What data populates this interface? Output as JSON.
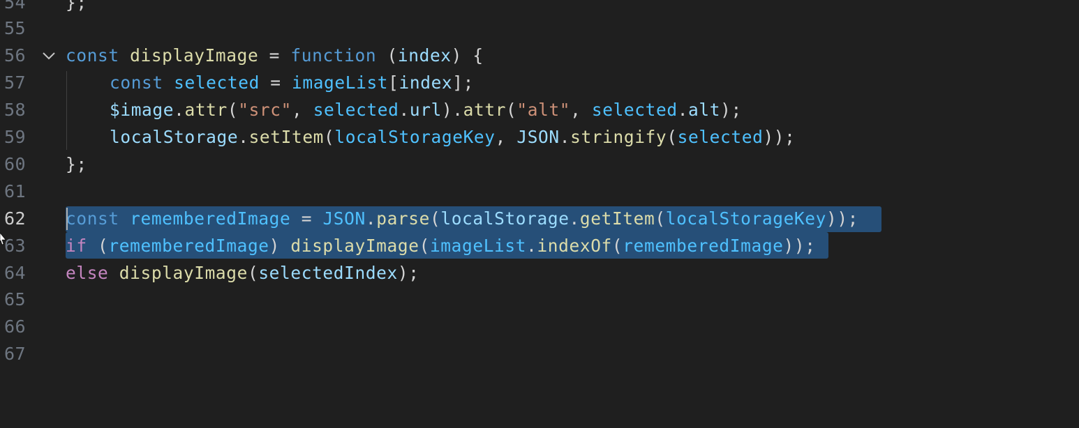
{
  "editor": {
    "active_line": "62",
    "lines": [
      {
        "number": "54",
        "code": "};"
      },
      {
        "number": "55",
        "code": ""
      },
      {
        "number": "56",
        "code": "const displayImage = function (index) {"
      },
      {
        "number": "57",
        "code": "const selected = imageList[index];"
      },
      {
        "number": "58",
        "code": "$image.attr(\"src\", selected.url).attr(\"alt\", selected.alt);"
      },
      {
        "number": "59",
        "code": "localStorage.setItem(localStorageKey, JSON.stringify(selected));"
      },
      {
        "number": "60",
        "code": "};"
      },
      {
        "number": "61",
        "code": ""
      },
      {
        "number": "62",
        "code": "const rememberedImage = JSON.parse(localStorage.getItem(localStorageKey));"
      },
      {
        "number": "63",
        "code": "if (rememberedImage) displayImage(imageList.indexOf(rememberedImage));"
      },
      {
        "number": "64",
        "code": "else displayImage(selectedIndex);"
      },
      {
        "number": "65",
        "code": ""
      },
      {
        "number": "66",
        "code": ""
      },
      {
        "number": "67",
        "code": ""
      }
    ],
    "tokens": {
      "l54": [
        "};"
      ],
      "l56": [
        "const",
        " ",
        "displayImage",
        " = ",
        "function",
        " (",
        "index",
        ") {"
      ],
      "l57": [
        "const",
        " ",
        "selected",
        " = ",
        "imageList",
        "[",
        "index",
        "];"
      ],
      "l58": [
        "$image",
        ".",
        "attr",
        "(",
        "\"src\"",
        ", ",
        "selected",
        ".",
        "url",
        ").",
        "attr",
        "(",
        "\"alt\"",
        ", ",
        "selected",
        ".",
        "alt",
        ");"
      ],
      "l59": [
        "localStorage",
        ".",
        "setItem",
        "(",
        "localStorageKey",
        ", ",
        "JSON",
        ".",
        "stringify",
        "(",
        "selected",
        "));"
      ],
      "l60": [
        "};"
      ],
      "l62": [
        "const",
        " ",
        "rememberedImage",
        " = ",
        "JSON",
        ".",
        "parse",
        "(",
        "localStorage",
        ".",
        "getItem",
        "(",
        "localStorageKey",
        "));"
      ],
      "l63": [
        "if",
        " (",
        "rememberedImage",
        ") ",
        "displayImage",
        "(",
        "imageList",
        ".",
        "indexOf",
        "(",
        "rememberedImage",
        "));"
      ],
      "l64": [
        "else",
        " ",
        "displayImage",
        "(",
        "selectedIndex",
        ");"
      ]
    }
  },
  "colors": {
    "background": "#1f1f1f",
    "selection": "#264f78",
    "keyword": "#569cd6",
    "control_keyword": "#c586c0",
    "function": "#dcdcaa",
    "constant": "#4fc1ff",
    "variable": "#9cdcfe",
    "string": "#ce9178",
    "punctuation": "#d4d4d4",
    "line_number": "#6e7681",
    "line_number_active": "#cccccc"
  },
  "icons": {
    "fold": "chevron-down-icon",
    "mouse": "mouse-pointer-icon"
  }
}
